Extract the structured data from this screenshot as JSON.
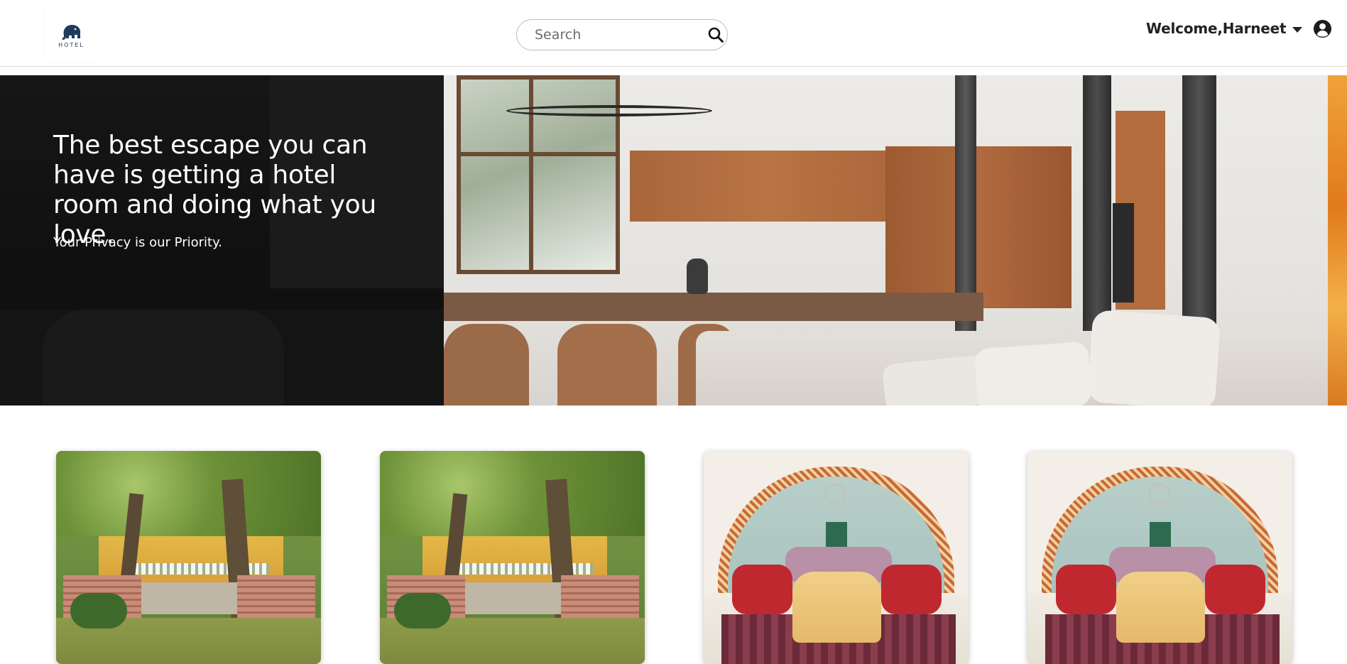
{
  "header": {
    "logo_text": "HOTEL",
    "search": {
      "placeholder": "Search"
    },
    "user": {
      "greeting": "Welcome,Harneet"
    }
  },
  "hero": {
    "title": "The best escape you can have is getting a hotel room and doing what you love.",
    "subtitle": "Your Privacy is our Priority."
  },
  "cards": [
    {
      "image": "garden-estate"
    },
    {
      "image": "garden-estate"
    },
    {
      "image": "palace-salon"
    },
    {
      "image": "palace-salon"
    }
  ],
  "icons": {
    "logo": "elephant-logo",
    "search": "search-icon",
    "caret": "caret-down-icon",
    "user": "user-circle-icon"
  },
  "colors": {
    "hero_dark": "#121212",
    "text_dark": "#222222",
    "navbar_border": "#d9d9d9"
  }
}
